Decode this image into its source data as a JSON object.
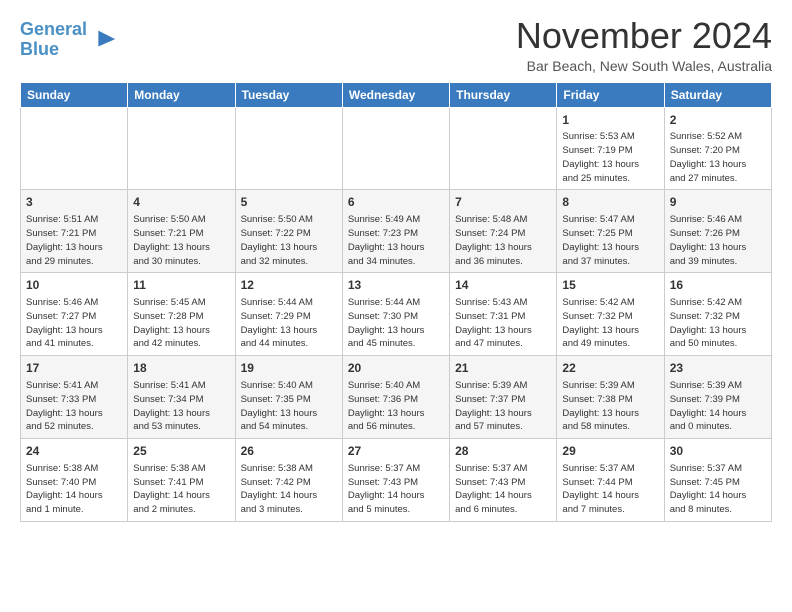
{
  "logo": {
    "line1": "General",
    "line2": "Blue"
  },
  "title": "November 2024",
  "location": "Bar Beach, New South Wales, Australia",
  "days_of_week": [
    "Sunday",
    "Monday",
    "Tuesday",
    "Wednesday",
    "Thursday",
    "Friday",
    "Saturday"
  ],
  "weeks": [
    [
      {
        "day": "",
        "info": ""
      },
      {
        "day": "",
        "info": ""
      },
      {
        "day": "",
        "info": ""
      },
      {
        "day": "",
        "info": ""
      },
      {
        "day": "",
        "info": ""
      },
      {
        "day": "1",
        "info": "Sunrise: 5:53 AM\nSunset: 7:19 PM\nDaylight: 13 hours\nand 25 minutes."
      },
      {
        "day": "2",
        "info": "Sunrise: 5:52 AM\nSunset: 7:20 PM\nDaylight: 13 hours\nand 27 minutes."
      }
    ],
    [
      {
        "day": "3",
        "info": "Sunrise: 5:51 AM\nSunset: 7:21 PM\nDaylight: 13 hours\nand 29 minutes."
      },
      {
        "day": "4",
        "info": "Sunrise: 5:50 AM\nSunset: 7:21 PM\nDaylight: 13 hours\nand 30 minutes."
      },
      {
        "day": "5",
        "info": "Sunrise: 5:50 AM\nSunset: 7:22 PM\nDaylight: 13 hours\nand 32 minutes."
      },
      {
        "day": "6",
        "info": "Sunrise: 5:49 AM\nSunset: 7:23 PM\nDaylight: 13 hours\nand 34 minutes."
      },
      {
        "day": "7",
        "info": "Sunrise: 5:48 AM\nSunset: 7:24 PM\nDaylight: 13 hours\nand 36 minutes."
      },
      {
        "day": "8",
        "info": "Sunrise: 5:47 AM\nSunset: 7:25 PM\nDaylight: 13 hours\nand 37 minutes."
      },
      {
        "day": "9",
        "info": "Sunrise: 5:46 AM\nSunset: 7:26 PM\nDaylight: 13 hours\nand 39 minutes."
      }
    ],
    [
      {
        "day": "10",
        "info": "Sunrise: 5:46 AM\nSunset: 7:27 PM\nDaylight: 13 hours\nand 41 minutes."
      },
      {
        "day": "11",
        "info": "Sunrise: 5:45 AM\nSunset: 7:28 PM\nDaylight: 13 hours\nand 42 minutes."
      },
      {
        "day": "12",
        "info": "Sunrise: 5:44 AM\nSunset: 7:29 PM\nDaylight: 13 hours\nand 44 minutes."
      },
      {
        "day": "13",
        "info": "Sunrise: 5:44 AM\nSunset: 7:30 PM\nDaylight: 13 hours\nand 45 minutes."
      },
      {
        "day": "14",
        "info": "Sunrise: 5:43 AM\nSunset: 7:31 PM\nDaylight: 13 hours\nand 47 minutes."
      },
      {
        "day": "15",
        "info": "Sunrise: 5:42 AM\nSunset: 7:32 PM\nDaylight: 13 hours\nand 49 minutes."
      },
      {
        "day": "16",
        "info": "Sunrise: 5:42 AM\nSunset: 7:32 PM\nDaylight: 13 hours\nand 50 minutes."
      }
    ],
    [
      {
        "day": "17",
        "info": "Sunrise: 5:41 AM\nSunset: 7:33 PM\nDaylight: 13 hours\nand 52 minutes."
      },
      {
        "day": "18",
        "info": "Sunrise: 5:41 AM\nSunset: 7:34 PM\nDaylight: 13 hours\nand 53 minutes."
      },
      {
        "day": "19",
        "info": "Sunrise: 5:40 AM\nSunset: 7:35 PM\nDaylight: 13 hours\nand 54 minutes."
      },
      {
        "day": "20",
        "info": "Sunrise: 5:40 AM\nSunset: 7:36 PM\nDaylight: 13 hours\nand 56 minutes."
      },
      {
        "day": "21",
        "info": "Sunrise: 5:39 AM\nSunset: 7:37 PM\nDaylight: 13 hours\nand 57 minutes."
      },
      {
        "day": "22",
        "info": "Sunrise: 5:39 AM\nSunset: 7:38 PM\nDaylight: 13 hours\nand 58 minutes."
      },
      {
        "day": "23",
        "info": "Sunrise: 5:39 AM\nSunset: 7:39 PM\nDaylight: 14 hours\nand 0 minutes."
      }
    ],
    [
      {
        "day": "24",
        "info": "Sunrise: 5:38 AM\nSunset: 7:40 PM\nDaylight: 14 hours\nand 1 minute."
      },
      {
        "day": "25",
        "info": "Sunrise: 5:38 AM\nSunset: 7:41 PM\nDaylight: 14 hours\nand 2 minutes."
      },
      {
        "day": "26",
        "info": "Sunrise: 5:38 AM\nSunset: 7:42 PM\nDaylight: 14 hours\nand 3 minutes."
      },
      {
        "day": "27",
        "info": "Sunrise: 5:37 AM\nSunset: 7:43 PM\nDaylight: 14 hours\nand 5 minutes."
      },
      {
        "day": "28",
        "info": "Sunrise: 5:37 AM\nSunset: 7:43 PM\nDaylight: 14 hours\nand 6 minutes."
      },
      {
        "day": "29",
        "info": "Sunrise: 5:37 AM\nSunset: 7:44 PM\nDaylight: 14 hours\nand 7 minutes."
      },
      {
        "day": "30",
        "info": "Sunrise: 5:37 AM\nSunset: 7:45 PM\nDaylight: 14 hours\nand 8 minutes."
      }
    ]
  ]
}
